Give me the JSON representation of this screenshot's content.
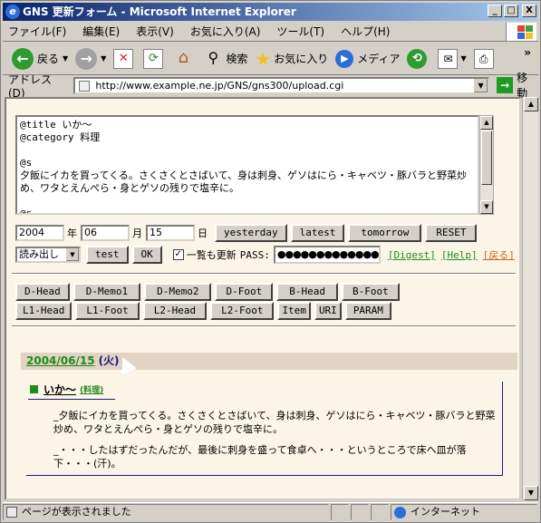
{
  "window": {
    "title": "GNS 更新フォーム - Microsoft Internet Explorer",
    "controls": {
      "minimize": "_",
      "maximize": "□",
      "close": "X"
    }
  },
  "menu": [
    "ファイル(F)",
    "編集(E)",
    "表示(V)",
    "お気に入り(A)",
    "ツール(T)",
    "ヘルプ(H)"
  ],
  "toolbar": {
    "back": "戻る",
    "search": "検索",
    "favorites": "お気に入り",
    "media": "メディア",
    "more": "»"
  },
  "address": {
    "label": "アドレス(D)",
    "url": "http://www.example.ne.jp/GNS/gns300/upload.cgi",
    "go": "移動"
  },
  "form": {
    "entry_text": "@title いか～\n@category 料理\n\n@s\n夕飯にイカを買ってくる。さくさくとさばいて、身は刺身、ゲソはにら・キャベツ・豚バラと野菜炒め、ワタとえんぺら・身とゲソの残りで塩辛に。\n\n@s",
    "year": "2004",
    "year_unit": "年",
    "month": "06",
    "month_unit": "月",
    "day": "15",
    "day_unit": "日",
    "buttons": {
      "yesterday": "yesterday",
      "latest": "latest",
      "tomorrow": "tomorrow",
      "reset": "RESET",
      "test": "test",
      "ok": "OK"
    },
    "mode_select": "読み出し",
    "update_list_label": "一覧も更新",
    "pass_label": "PASS:",
    "pass_value": "●●●●●●●●●●●●●",
    "links": {
      "digest": "[Digest]",
      "help": "[Help]",
      "back": "[戻る]"
    }
  },
  "tag_buttons": {
    "row1": [
      "D-Head",
      "D-Memo1",
      "D-Memo2",
      "D-Foot",
      "B-Head",
      "B-Foot"
    ],
    "row2": [
      "L1-Head",
      "L1-Foot",
      "L2-Head",
      "L2-Foot",
      "Item",
      "URI",
      "PARAM"
    ]
  },
  "preview": {
    "date": "2004/06/15",
    "weekday": "(火)",
    "entry_title": "いか～",
    "category": "(料理)",
    "paragraphs": [
      "_夕飯にイカを買ってくる。さくさくとさばいて、身は刺身、ゲソはにら・キャベツ・豚バラと野菜炒め、ワタとえんぺら・身とゲソの残りで塩辛に。",
      "_・・・したはずだったんだが、最後に刺身を盛って食卓へ・・・というところで床へ皿が落下・・・(汗)。"
    ]
  },
  "status": {
    "message": "ページが表示されました",
    "zone": "インターネット"
  }
}
